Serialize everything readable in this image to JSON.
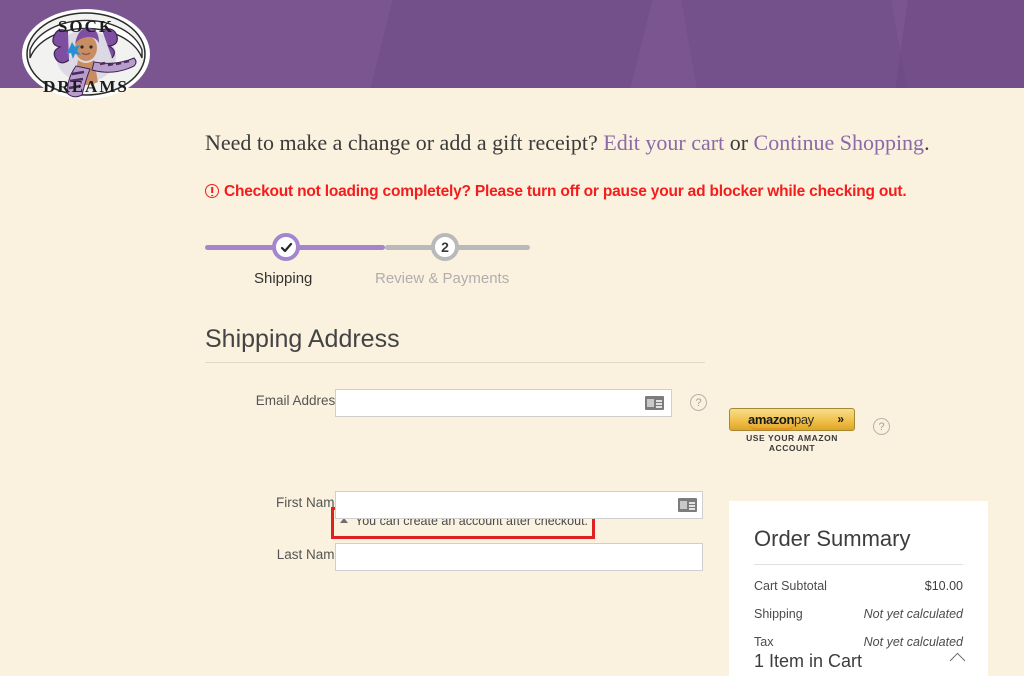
{
  "brand": {
    "logo_top_text": "SOCK",
    "logo_bottom_text": "DREAMS",
    "logo_name": "Sock Dreams"
  },
  "colors": {
    "header_purple": "#7a5590",
    "page_cream": "#faf1de",
    "link_purple": "#8a6aa8",
    "alert_red": "#f51c1c",
    "annotation_red": "#e02020",
    "step_active": "#a386cd",
    "step_inactive": "#b9b9b9",
    "amazon_gold": "#f0c14b"
  },
  "notice": {
    "change_prefix": "Need to make a change or add a gift receipt?",
    "edit_cart_link": "Edit your cart",
    "conjunction": "or",
    "continue_link": "Continue Shopping",
    "period": ".",
    "adblock_warning": "Checkout not loading completely? Please turn off or pause your ad blocker while checking out."
  },
  "stepper": {
    "steps": [
      {
        "label": "Shipping",
        "state": "complete",
        "marker": "✔"
      },
      {
        "label": "Review & Payments",
        "state": "upcoming",
        "marker": "2"
      }
    ]
  },
  "shipping_form": {
    "title": "Shipping Address",
    "fields": [
      {
        "label": "Email Address",
        "value": "",
        "required_marker": "*",
        "autofill_icon": "credit-card-autofill-icon",
        "help_icon": "question-mark-icon"
      },
      {
        "label": "First Name",
        "value": "",
        "required_marker": "*",
        "autofill_icon": "contact-card-autofill-icon"
      },
      {
        "label": "Last Name",
        "value": "",
        "required_marker": "*"
      }
    ],
    "account_hint": "You can create an account after checkout."
  },
  "amazon_pay": {
    "word_amazon": "amazon",
    "word_pay": "pay",
    "chevron": "»",
    "subtitle": "USE YOUR AMAZON ACCOUNT",
    "help_icon": "question-mark-icon"
  },
  "order_summary": {
    "title": "Order Summary",
    "rows": [
      {
        "label": "Cart Subtotal",
        "value": "$10.00",
        "pending": false
      },
      {
        "label": "Shipping",
        "value": "Not yet calculated",
        "pending": true
      },
      {
        "label": "Tax",
        "value": "Not yet calculated",
        "pending": true
      }
    ],
    "cart_count_label": "1 Item in Cart"
  }
}
